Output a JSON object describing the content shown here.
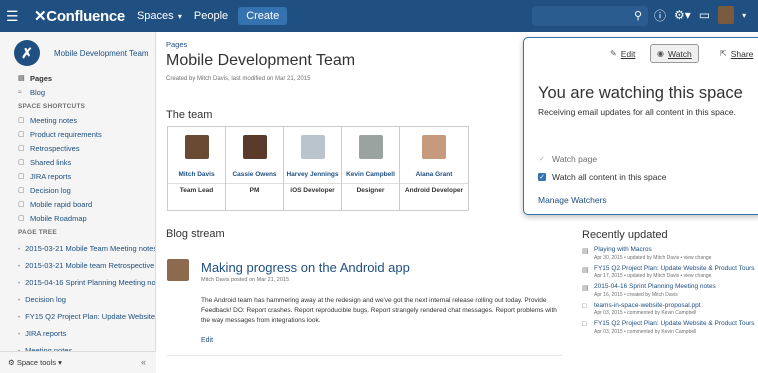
{
  "topbar": {
    "logo": "Confluence",
    "spaces_label": "Spaces",
    "people_label": "People",
    "create_label": "Create"
  },
  "sidebar": {
    "space_name": "Mobile Development Team",
    "pages_label": "Pages",
    "blog_label": "Blog",
    "shortcuts_heading": "SPACE SHORTCUTS",
    "shortcuts": [
      "Meeting notes",
      "Product requirements",
      "Retrospectives",
      "Shared links",
      "JIRA reports",
      "Decision log",
      "Mobile rapid board",
      "Mobile Roadmap"
    ],
    "tree_heading": "PAGE TREE",
    "tree": [
      "2015-03-21 Mobile Team Meeting notes",
      "2015-03-21 Mobile team Retrospective",
      "2015-04-16 Sprint Planning Meeting notes",
      "Decision log",
      "FY15 Q2 Project Plan: Update Website",
      "JIRA reports",
      "Meeting notes"
    ],
    "space_tools_label": "Space tools",
    "collapse_glyph": "«"
  },
  "main": {
    "breadcrumb": "Pages",
    "title": "Mobile Development Team",
    "byline": "Created by Mitch Davis, last modified on Mar 21, 2015",
    "team_heading": "The team",
    "team": [
      {
        "name": "Mitch Davis",
        "role": "Team Lead",
        "photo_color": "#6b4a34"
      },
      {
        "name": "Cassie Owens",
        "role": "PM",
        "photo_color": "#5a3a2a"
      },
      {
        "name": "Harvey Jennings",
        "role": "iOS Developer",
        "photo_color": "#b9c4cc"
      },
      {
        "name": "Kevin Campbell",
        "role": "Designer",
        "photo_color": "#9aa3a0"
      },
      {
        "name": "Alana Grant",
        "role": "Android Developer",
        "photo_color": "#c79a7d"
      }
    ],
    "blog_heading": "Blog stream",
    "post": {
      "title": "Making progress on the Android app",
      "meta": "Mitch Davis posted on Mar 21, 2015",
      "body": "The Android team has hammering away at the redesign and we've got the next internal release rolling out today. Provide Feedback! DO: Report crashes. Report reproducible bugs. Report strangely rendered chat messages. Report problems with the way messages from integrations look.",
      "edit_label": "Edit"
    }
  },
  "recent": {
    "heading": "Recently updated",
    "items": [
      {
        "title": "Playing with Macros",
        "meta": "Apr 30, 2015 • updated by Mitch Davis • view change",
        "icon": "page-icon"
      },
      {
        "title": "FY15 Q2 Project Plan: Update Website & Product Tours",
        "meta": "Apr 17, 2015 • updated by Mitch Davis • view change",
        "icon": "page-icon"
      },
      {
        "title": "2015-04-16 Sprint Planning Meeting notes",
        "meta": "Apr 16, 2015 • created by Mitch Davis",
        "icon": "page-icon"
      },
      {
        "title": "teams-in-space-website-proposal.ppt",
        "meta": "Apr 03, 2015 • commented by Kevin Campbell",
        "icon": "comment-icon"
      },
      {
        "title": "FY15 Q2 Project Plan: Update Website & Product Tours",
        "meta": "Apr 03, 2015 • commented by Kevin Campbell",
        "icon": "comment-icon"
      }
    ]
  },
  "watch": {
    "edit_label": "Edit",
    "watch_label": "Watch",
    "share_label": "Share",
    "heading": "You are watching this space",
    "description": "Receiving email updates for all content in this space.",
    "watch_page_label": "Watch page",
    "watch_all_label": "Watch all content in this space",
    "manage_label": "Manage Watchers",
    "watch_page_checked": true,
    "watch_all_checked": true
  },
  "colors": {
    "nav": "#205081",
    "link": "#205081",
    "accent": "#3572b0"
  }
}
